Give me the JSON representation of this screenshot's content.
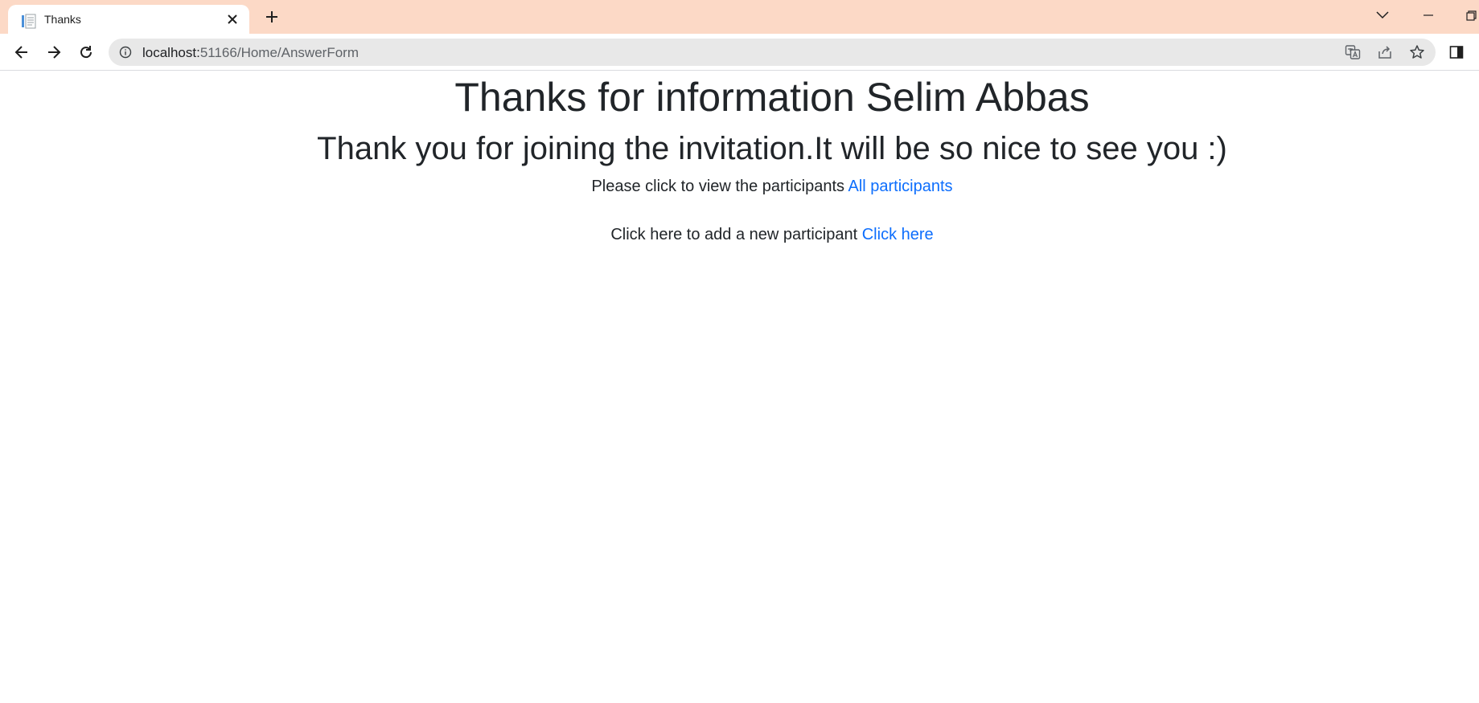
{
  "browser": {
    "tab": {
      "title": "Thanks",
      "favicon": "page-icon"
    },
    "url": {
      "host": "localhost:",
      "path": "51166/Home/AnswerForm"
    }
  },
  "page": {
    "heading": "Thanks for information Selim Abbas",
    "subheading": "Thank you for joining the invitation.It will be so nice to see you :)",
    "participants_text": "Please click to view the participants",
    "participants_link": "All participants",
    "add_text": "Click here to add a new participant",
    "add_link": "Click here"
  },
  "colors": {
    "tabstrip": "#fcd9c6",
    "link": "#0d6efd",
    "text": "#212529"
  }
}
